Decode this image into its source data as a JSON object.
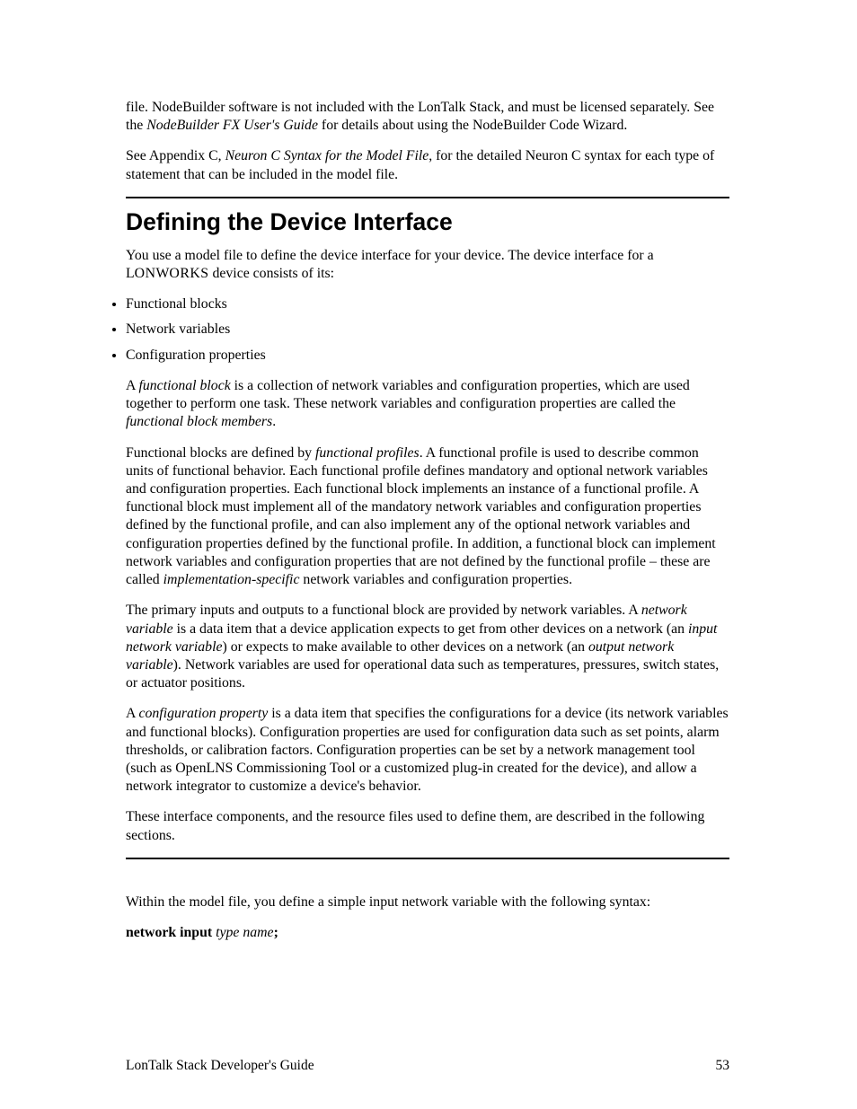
{
  "intro": {
    "p1a": "file.  NodeBuilder software is not included with the LonTalk Stack, and must be licensed separately.  See the ",
    "p1b": "NodeBuilder FX User's Guide",
    "p1c": " for details about using the NodeBuilder Code Wizard.",
    "p2a": "See Appendix C, ",
    "p2b": "Neuron C Syntax for the Model File",
    "p2c": ", for the detailed Neuron C syntax for each type of statement that can be included in the model file."
  },
  "section": {
    "heading": "Defining the Device Interface",
    "p1a": "You use a model file to define the device interface for your device.  The device interface for a L",
    "p1b": "ON",
    "p1c": "W",
    "p1d": "ORKS",
    "p1e": " device consists of its:",
    "bullets": [
      "Functional blocks",
      "Network variables",
      "Configuration properties"
    ],
    "p2a": "A ",
    "p2b": "functional block",
    "p2c": " is a collection of network variables and configuration properties, which are used together to perform one task.  These network variables and configuration properties are called the ",
    "p2d": "functional block members",
    "p2e": ".",
    "p3a": "Functional blocks are defined by ",
    "p3b": "functional profiles",
    "p3c": ".  A functional profile is used to describe common units of functional behavior.  Each functional profile defines mandatory and optional network variables and configuration properties.  Each functional block implements an instance of a functional profile.  A functional block must implement all of the mandatory network variables and configuration properties defined by the functional profile, and can also implement any of the optional network variables and configuration properties defined by the functional profile.  In addition, a functional block can implement network variables and configuration properties that are not defined by the functional profile – these are called ",
    "p3d": "implementation-specific",
    "p3e": " network variables and configuration properties.",
    "p4a": "The primary inputs and outputs to a functional block are provided by network variables.  A ",
    "p4b": "network variable",
    "p4c": " is a data item that a device application expects to get from other devices on a network (an ",
    "p4d": "input network variable",
    "p4e": ") or expects to make available to other devices on a network (an ",
    "p4f": "output network variable",
    "p4g": ").  Network variables are used for operational data such as temperatures, pressures, switch states, or actuator positions.",
    "p5a": "A ",
    "p5b": "configuration property",
    "p5c": " is a data item that specifies the configurations for a device (its network variables and functional blocks).  Configuration properties are used for configuration data such as set points, alarm thresholds, or calibration factors.  Configuration properties can be set by a network management tool (such as OpenLNS Commissioning Tool or a customized plug-in created for the device), and allow a network integrator to customize a device's behavior.",
    "p6": "These interface components, and the resource files used to define them, are described in the following sections."
  },
  "syntax": {
    "p1": "Within the model file, you define a simple input network variable with the following syntax:",
    "kw1": "network input ",
    "it1": "type name",
    "kw2": ";"
  },
  "footer": {
    "left": "LonTalk Stack Developer's Guide",
    "right": "53"
  }
}
